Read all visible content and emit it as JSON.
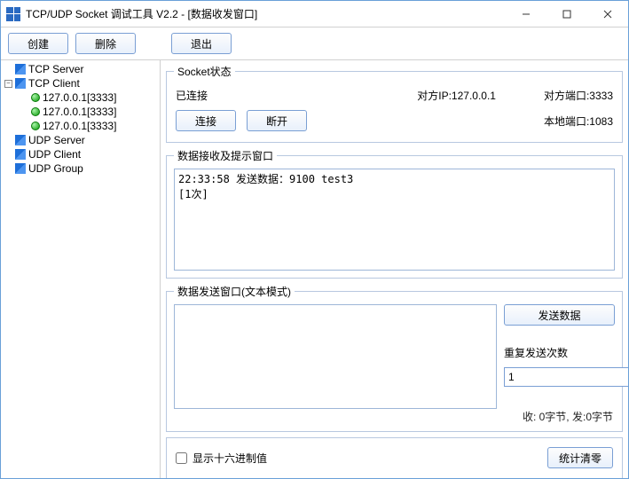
{
  "titlebar": {
    "title": "TCP/UDP Socket 调试工具 V2.2 - [数据收发窗口]"
  },
  "toolbar": {
    "create": "创建",
    "delete": "删除",
    "exit": "退出"
  },
  "tree": {
    "tcp_server": "TCP Server",
    "tcp_client": "TCP Client",
    "clients": [
      "127.0.0.1[3333]",
      "127.0.0.1[3333]",
      "127.0.0.1[3333]"
    ],
    "udp_server": "UDP Server",
    "udp_client": "UDP Client",
    "udp_group": "UDP Group"
  },
  "socket_status": {
    "legend": "Socket状态",
    "state": "已连接",
    "peer_ip_label": "对方IP:127.0.0.1",
    "peer_port_label": "对方端口:3333",
    "connect_btn": "连接",
    "disconnect_btn": "断开",
    "local_port_label": "本地端口:1083"
  },
  "recv": {
    "legend": "数据接收及提示窗口",
    "log": "22:33:58 发送数据：9100 test3\n[1次]"
  },
  "send": {
    "legend": "数据发送窗口(文本模式)",
    "text": "",
    "send_btn": "发送数据",
    "repeat_label": "重复发送次数",
    "repeat_value": "1",
    "stats": "收: 0字节,  发:0字节"
  },
  "bottom": {
    "hex_checkbox": "显示十六进制值",
    "stats_clear_btn": "统计清零"
  }
}
